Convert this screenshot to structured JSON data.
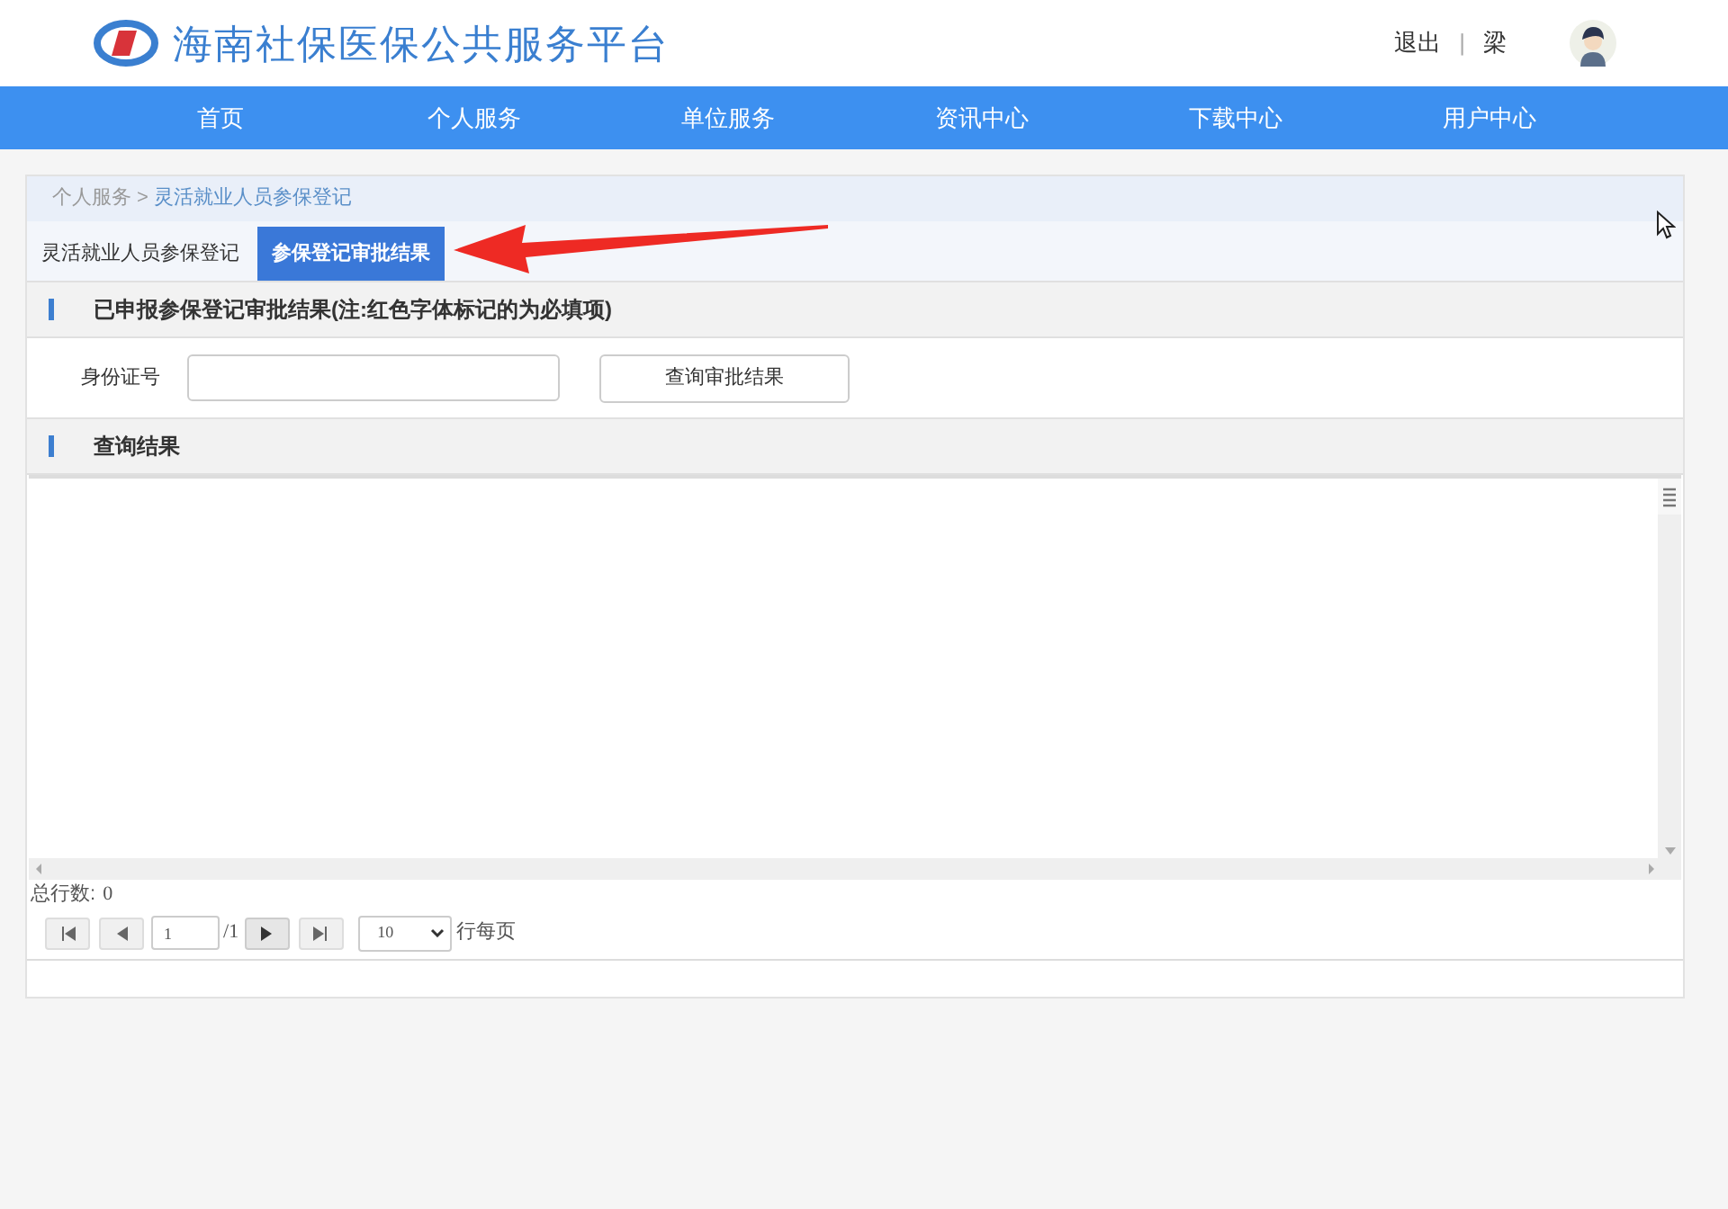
{
  "site_title": "海南社保医保公共服务平台",
  "user_links": {
    "logout": "退出",
    "separator": "|",
    "user_name": "梁"
  },
  "nav": [
    "首页",
    "个人服务",
    "单位服务",
    "资讯中心",
    "下载中心",
    "用户中心"
  ],
  "breadcrumb": {
    "parent": "个人服务",
    "separator": ">",
    "current": "灵活就业人员参保登记"
  },
  "tabs": [
    {
      "label": "灵活就业人员参保登记",
      "selected": false
    },
    {
      "label": "参保登记审批结果",
      "selected": true
    }
  ],
  "query_section": {
    "title": "已申报参保登记审批结果(注:红色字体标记的为必填项)",
    "field_label": "身份证号",
    "button": "查询审批结果"
  },
  "result_section": {
    "title": "查询结果"
  },
  "grid": {
    "total_label": "总行数:",
    "total": "0",
    "page": "1",
    "page_count_prefix": "/",
    "page_count": "1",
    "page_size": "10",
    "page_size_suffix": "行每页"
  }
}
